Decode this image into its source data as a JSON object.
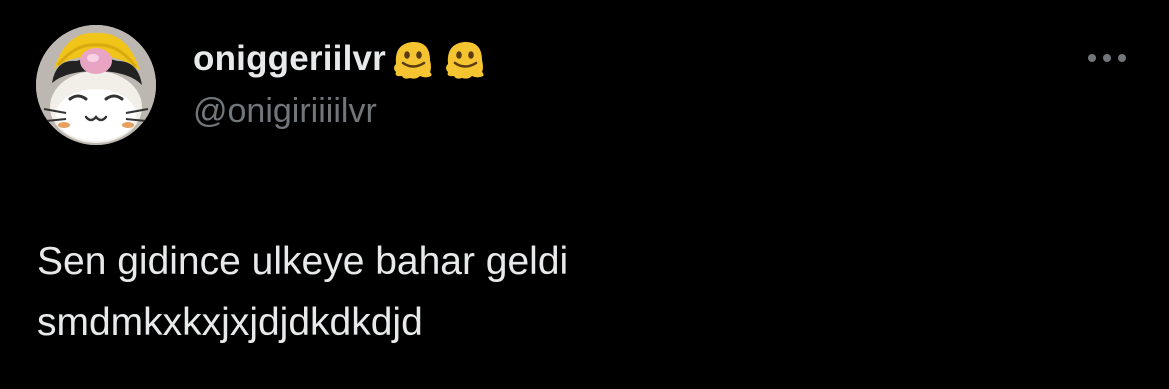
{
  "tweet": {
    "author": {
      "display_name": "oniggeriilvr",
      "handle": "@onigiriiiilvr",
      "emojis": [
        "melting-face-emoji",
        "melting-face-emoji"
      ],
      "avatar": "cat-onigiri-avatar"
    },
    "more_icon": "more-horizontal-icon",
    "text_lines": [
      "Sen gidince ulkeye bahar geldi",
      "smdmkxkxjxjdjdkdkdjd"
    ]
  },
  "colors": {
    "background": "#000000",
    "text_primary": "#e7e9ea",
    "text_secondary": "#71767b",
    "emoji_yellow": "#f5c431"
  }
}
